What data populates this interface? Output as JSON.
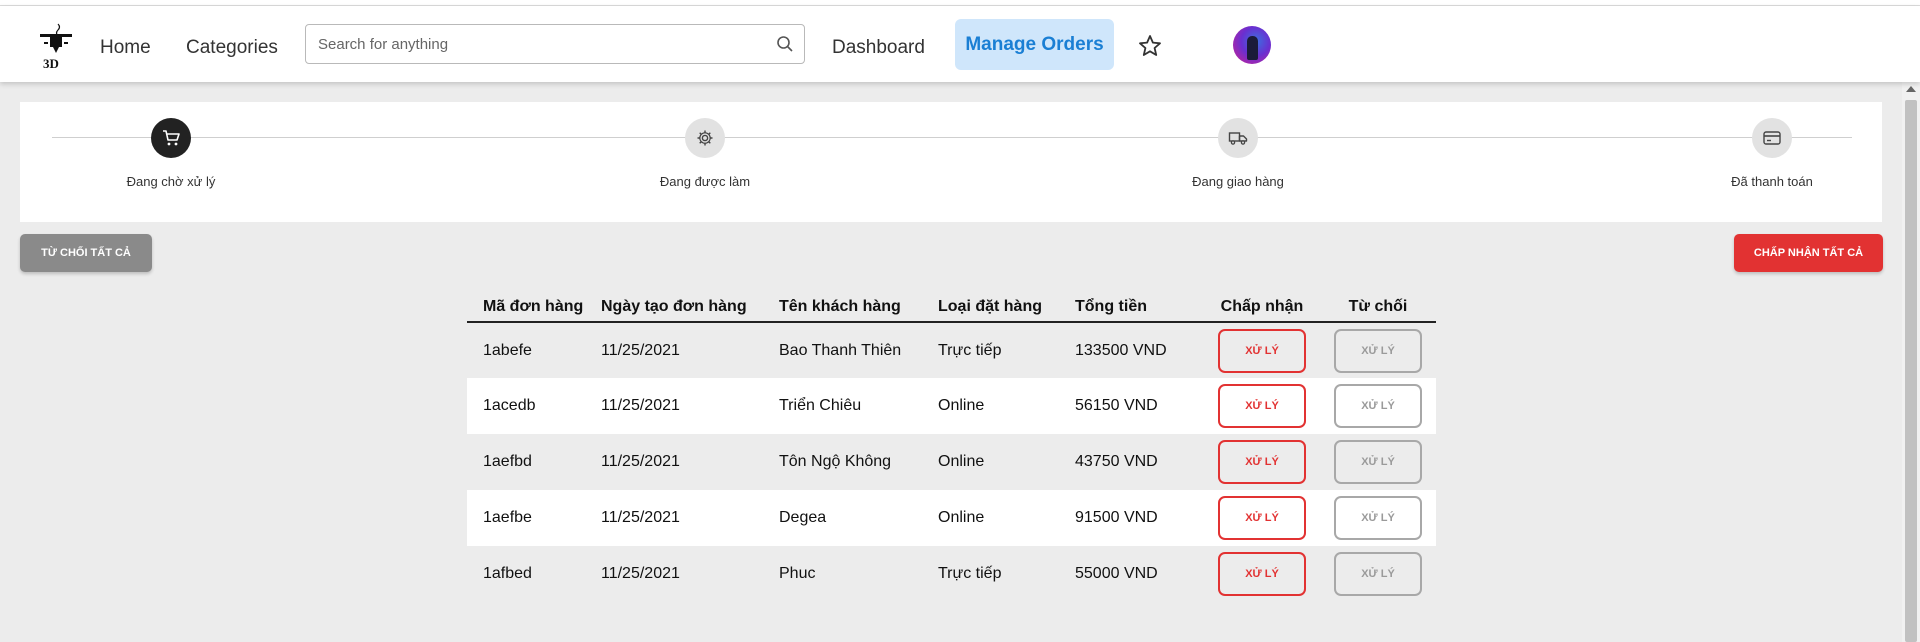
{
  "nav": {
    "home": "Home",
    "categories": "Categories",
    "search_placeholder": "Search for anything",
    "dashboard": "Dashboard",
    "manage_orders": "Manage Orders",
    "logo_text": "3D"
  },
  "steps": [
    {
      "label": "Đang chờ xử lý",
      "icon": "cart-icon",
      "active": true
    },
    {
      "label": "Đang được làm",
      "icon": "gear-icon",
      "active": false
    },
    {
      "label": "Đang giao hàng",
      "icon": "truck-icon",
      "active": false
    },
    {
      "label": "Đã thanh toán",
      "icon": "credit-card-icon",
      "active": false
    }
  ],
  "actions": {
    "reject_all": "TỪ CHỐI TẤT CẢ",
    "accept_all": "CHẤP NHẬN TẤT CẢ"
  },
  "table": {
    "headers": [
      "Mã đơn hàng",
      "Ngày tạo đơn hàng",
      "Tên khách hàng",
      "Loại đặt hàng",
      "Tổng tiền",
      "Chấp nhận",
      "Từ chối"
    ],
    "button_label": "XỬ LÝ",
    "rows": [
      {
        "id": "1abefe",
        "date": "11/25/2021",
        "customer": "Bao Thanh Thiên",
        "type": "Trực tiếp",
        "total": "133500 VND"
      },
      {
        "id": "1acedb",
        "date": "11/25/2021",
        "customer": "Triển Chiêu",
        "type": "Online",
        "total": "56150 VND"
      },
      {
        "id": "1aefbd",
        "date": "11/25/2021",
        "customer": "Tôn Ngộ Không",
        "type": "Online",
        "total": "43750 VND"
      },
      {
        "id": "1aefbe",
        "date": "11/25/2021",
        "customer": "Degea",
        "type": "Online",
        "total": "91500 VND"
      },
      {
        "id": "1afbed",
        "date": "11/25/2021",
        "customer": "Phuc",
        "type": "Trực tiếp",
        "total": "55000 VND"
      }
    ]
  },
  "colors": {
    "accent_blue": "#1a7fd4",
    "active_tab_bg": "#cfe6fb",
    "accept_red": "#e23232",
    "reject_grey": "#8a8a8a"
  }
}
